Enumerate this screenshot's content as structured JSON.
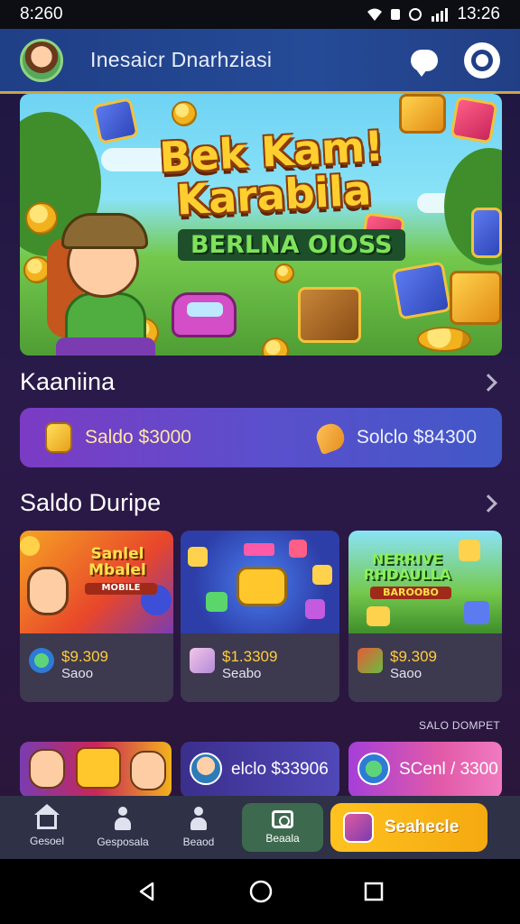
{
  "status_bar": {
    "time": "8:260",
    "right_time": "13:26"
  },
  "header": {
    "title": "Inesaicr Dnarhziasi"
  },
  "hero": {
    "title_line1": "Bek Kam!",
    "title_line2": "Karabila",
    "subtitle": "BERLNA OIOSS"
  },
  "balance_section": {
    "title": "Kaaniina",
    "left_label": "Saldo $3000",
    "right_label": "Solclo $84300"
  },
  "games_section": {
    "title": "Saldo Duripe",
    "cards": [
      {
        "thumb_text": "Sanlel Mbalel",
        "thumb_sub": "MOBILE",
        "price": "$9.309",
        "sub": "Saoo"
      },
      {
        "thumb_text": "",
        "thumb_sub": "",
        "price": "$1.3309",
        "sub": "Seabo"
      },
      {
        "thumb_text": "NERRIVE RHDAULLA",
        "thumb_sub": "BAROOBO",
        "price": "$9.309",
        "sub": "Saoo"
      }
    ]
  },
  "promo_label": "SALO DOMPET",
  "mini_cards": [
    {
      "text": ""
    },
    {
      "text": "elclo $33906"
    },
    {
      "text": "SCenl / 3300"
    }
  ],
  "bottom_nav": {
    "items": [
      {
        "label": "Gesoel",
        "icon": "home-icon"
      },
      {
        "label": "Gesposala",
        "icon": "person-icon"
      },
      {
        "label": "Beaod",
        "icon": "person-icon"
      }
    ],
    "active": {
      "label": "Beaala",
      "icon": "camera-icon"
    },
    "search": {
      "label": "Seahecle"
    }
  }
}
